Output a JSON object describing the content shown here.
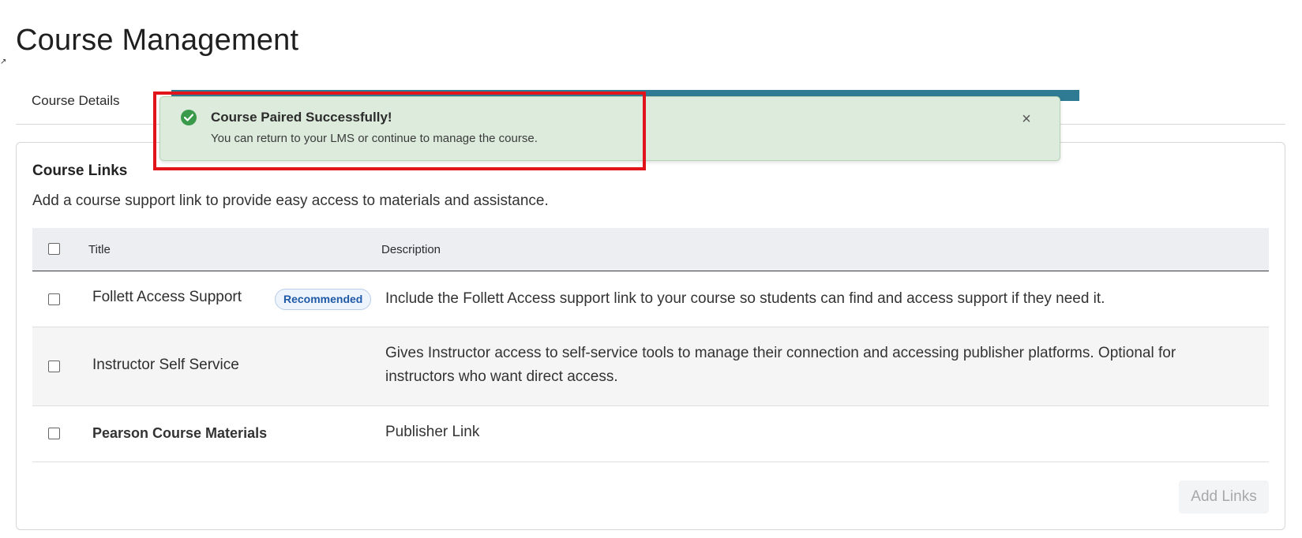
{
  "page": {
    "title": "Course Management"
  },
  "tabs": [
    {
      "label": "Course Details"
    }
  ],
  "toast": {
    "title": "Course Paired Successfully!",
    "message": "You can return to your LMS or continue to manage the course.",
    "close_glyph": "×",
    "status_color": "#3a9a4b",
    "background_color": "#dcebdc"
  },
  "course_links": {
    "title": "Course Links",
    "description": "Add a course support link to provide easy access to materials and assistance.",
    "columns": {
      "title": "Title",
      "description": "Description"
    },
    "rows": [
      {
        "title": "Follett Access Support",
        "badge": "Recommended",
        "description": "Include the Follett Access support link to your course so students can find and access support if they need it."
      },
      {
        "title": "Instructor Self Service",
        "description": "Gives Instructor access to self-service tools to manage their connection and accessing publisher platforms. Optional for instructors who want direct access."
      },
      {
        "title": "Pearson Course Materials",
        "description": "Publisher Link"
      }
    ],
    "add_button_label": "Add Links"
  },
  "colors": {
    "accent_bar": "#2f7b93",
    "highlight": "#e0141a",
    "badge_text": "#1e5aa6"
  }
}
